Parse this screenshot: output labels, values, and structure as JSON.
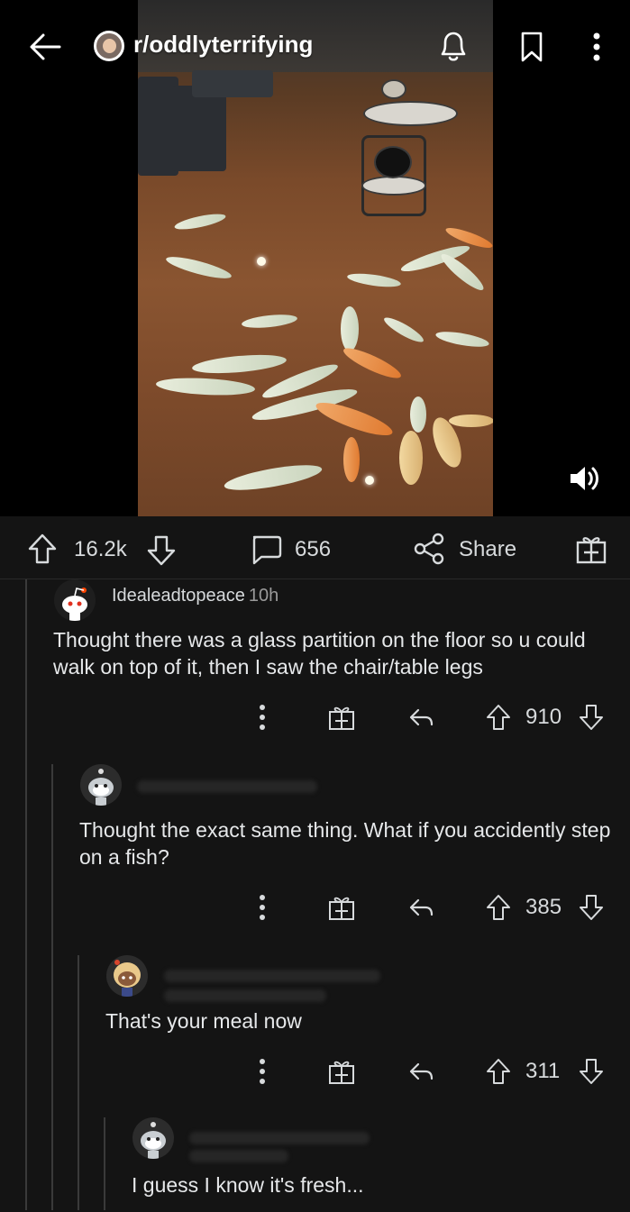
{
  "header": {
    "back_icon": "arrow-left-icon",
    "subreddit": "r/oddlyterrifying",
    "notify_icon": "bell-icon",
    "save_icon": "bookmark-icon",
    "more_icon": "kebab-menu-icon"
  },
  "video": {
    "volume_icon": "volume-icon"
  },
  "post_actions": {
    "upvotes": "16.2k",
    "comments": "656",
    "share_label": "Share",
    "award_icon": "gift-icon"
  },
  "comments": [
    {
      "author": "Idealeadtopeace",
      "time": "10h",
      "body": "Thought there was a glass partition on the floor so u could walk on top of it, then I saw the chair/table legs",
      "score": "910"
    },
    {
      "body": "Thought the exact same thing. What if you accidently step on a fish?",
      "score": "385"
    },
    {
      "body": "That's your meal now",
      "score": "311"
    },
    {
      "body": "I guess I know it's fresh..."
    }
  ],
  "colors": {
    "background": "#141414",
    "text": "#d7dadc",
    "thread_line": "#3a3a3a"
  }
}
